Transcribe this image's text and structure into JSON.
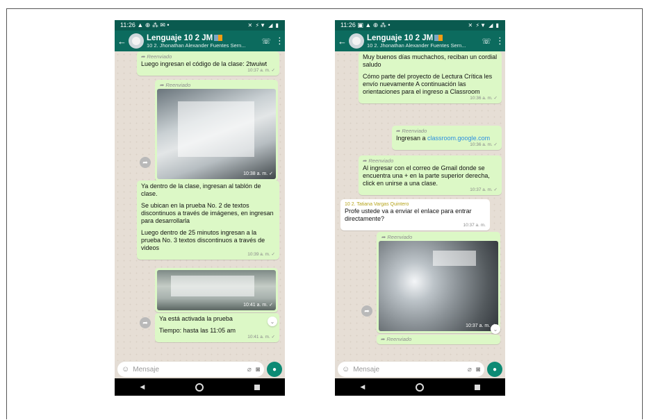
{
  "phones": [
    {
      "status": {
        "time": "11:26",
        "left_icons": "▲ ⊕ ⁂ ✉ •",
        "right_icons": "✕ ⚡▼ ◢ ▮"
      },
      "header": {
        "title": "Lenguaje 10 2 JM",
        "subtitle": "10 2. Jhonathan Alexander Fuentes Sern..."
      },
      "messages": [
        {
          "forwarded": "Reenviado",
          "text": "Luego ingresan el código de la clase: 2twuiwt",
          "time": "10:37 a. m. ✓"
        },
        {
          "forwarded": "Reenviado",
          "photo_time": "10:38 a. m. ✓"
        },
        {
          "paragraphs": [
            "Ya dentro de la clase, ingresan al tablón de clase.",
            "Se ubican en la prueba No. 2 de textos discontinuos a través de imágenes, en ingresan para desarrollarla",
            "Luego dentro de 25 minutos ingresan a la prueba No. 3 textos discontinuos a través de videos"
          ],
          "time": "10:39 a. m. ✓"
        },
        {
          "photo_time": "10:41 a. m. ✓"
        },
        {
          "paragraphs": [
            "Ya está activada la prueba",
            "Tiempo: hasta las 11:05 am"
          ],
          "time": "10:41 a. m. ✓"
        }
      ],
      "input": {
        "placeholder": "Mensaje"
      }
    },
    {
      "status": {
        "time": "11:26",
        "left_icons": "▣ ▲ ⊕ ⁂ •",
        "right_icons": "✕ ⚡▼ ◢ ▮"
      },
      "header": {
        "title": "Lenguaje 10 2 JM",
        "subtitle": "10 2. Jhonathan Alexander Fuentes Sern..."
      },
      "messages": [
        {
          "paragraphs": [
            "Muy buenos días muchachos, reciban un cordial saludo",
            "Cómo parte del proyecto de Lectura Crítica les envío nuevamente A continuación las orientaciones para el ingreso a Classroom"
          ],
          "time": "10:36 a. m. ✓"
        },
        {
          "forwarded": "Reenviado",
          "text_prefix": "Ingresan a ",
          "link": "classroom.google.com",
          "time": "10:36 a. m. ✓"
        },
        {
          "forwarded": "Reenviado",
          "text": "Al ingresar con el correo de Gmail donde se encuentra una + en la parte superior derecha, click en unirse a una clase.",
          "time": "10:37 a. m. ✓"
        },
        {
          "sender": "10 2. Tatiana Vargas Quintero",
          "text": "Profe ustede va a enviar el enlace para entrar directamente?",
          "time": "10:37 a. m."
        },
        {
          "forwarded": "Reenviado",
          "photo_time": "10:37 a. m. ✓"
        },
        {
          "forwarded": "Reenviado"
        }
      ],
      "input": {
        "placeholder": "Mensaje"
      }
    }
  ]
}
